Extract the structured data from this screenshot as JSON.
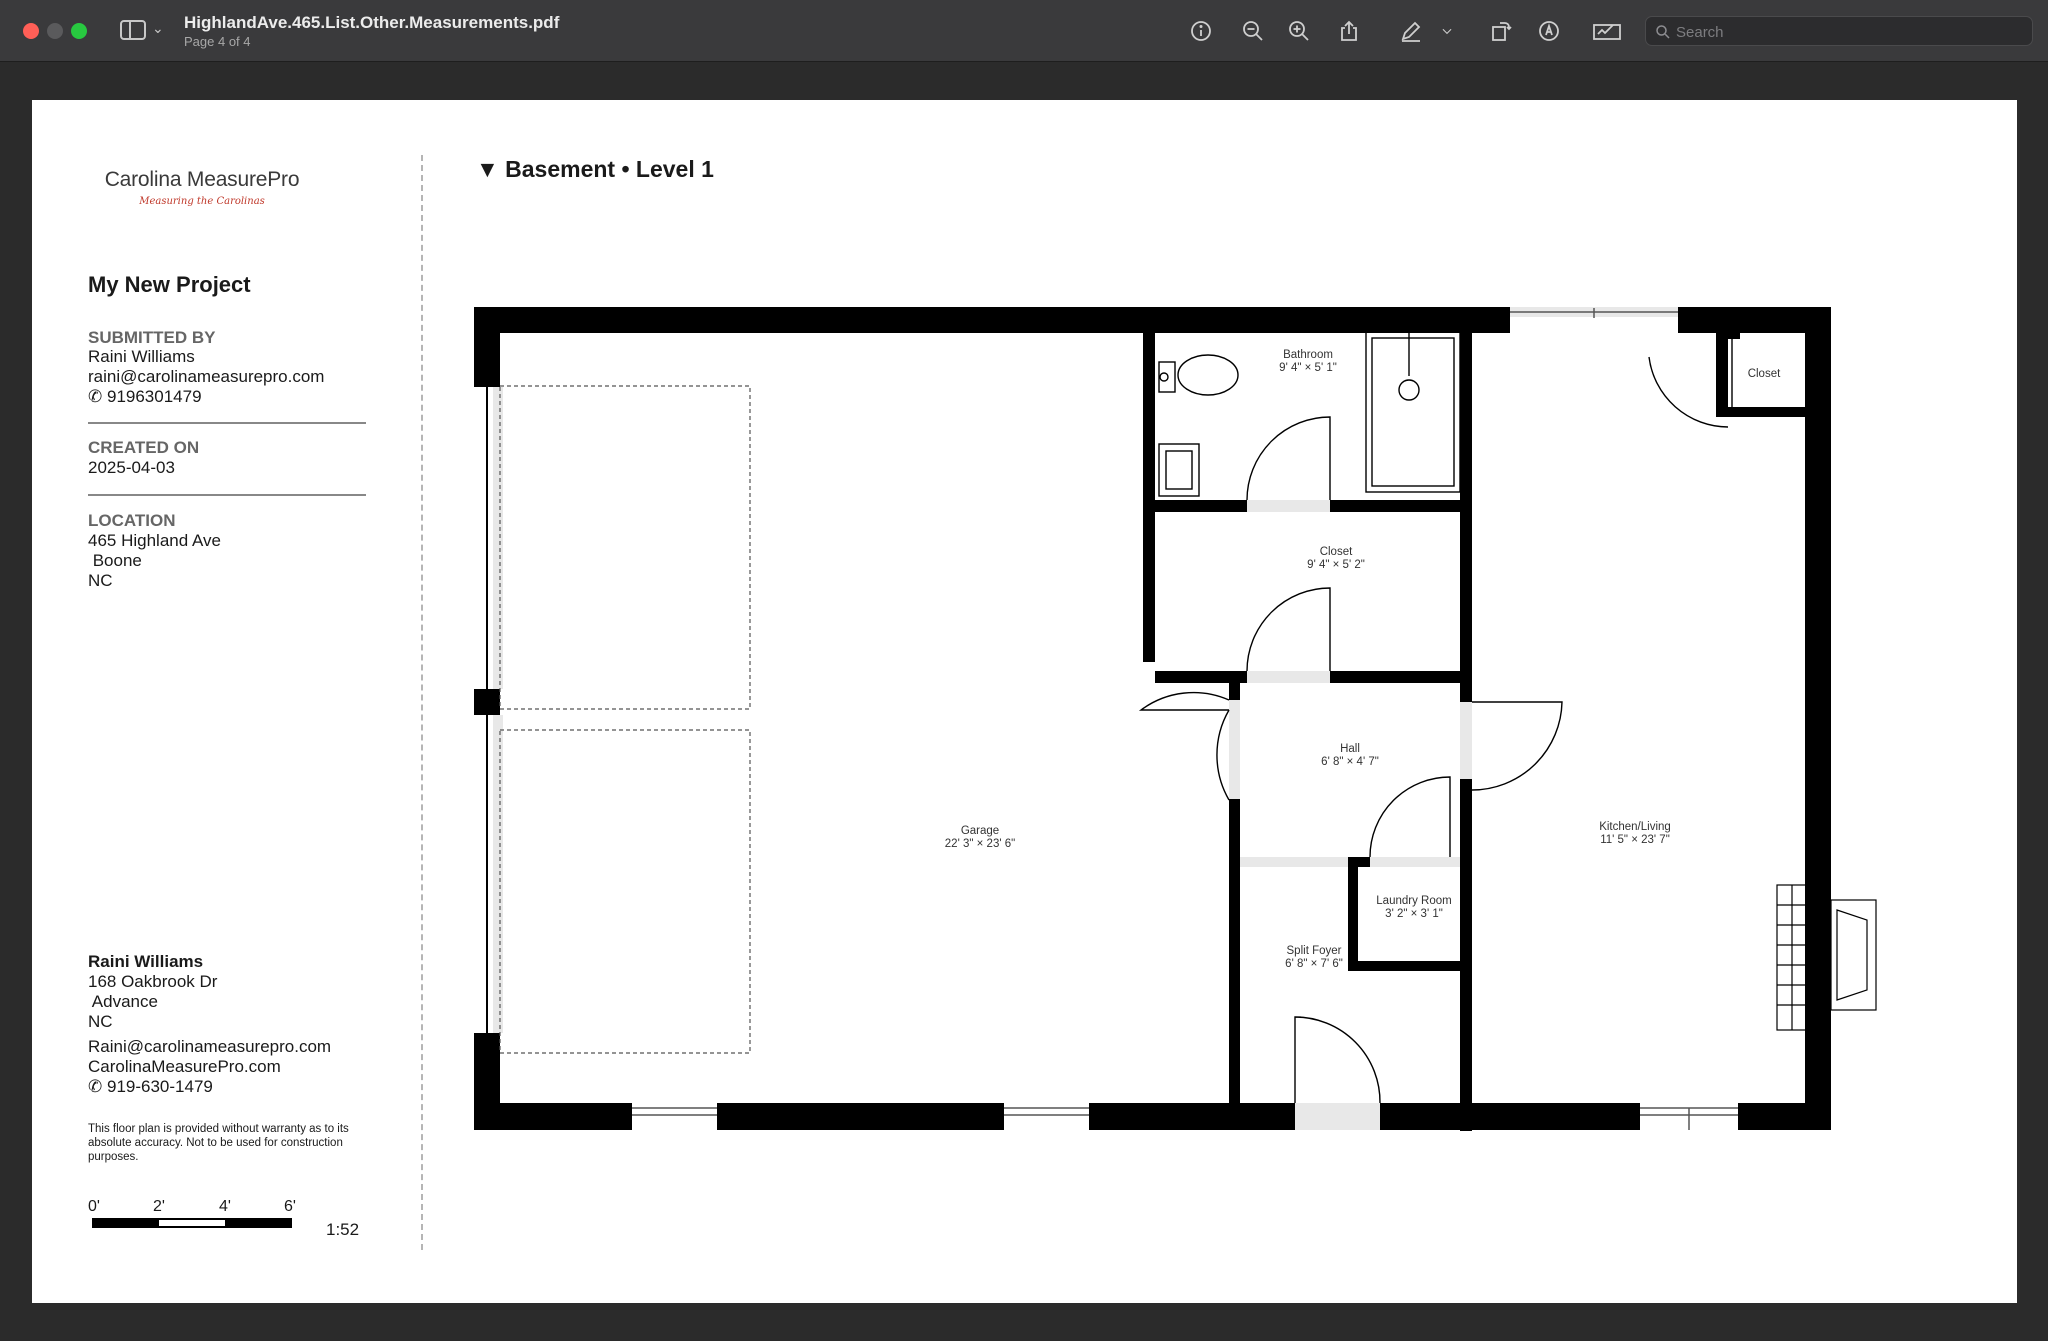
{
  "window": {
    "title": "HighlandAve.465.List.Other.Measurements.pdf",
    "subtitle": "Page 4 of 4"
  },
  "toolbar": {
    "icons": [
      "info-icon",
      "zoom-out-icon",
      "zoom-in-icon",
      "share-icon",
      "markup-pen-icon",
      "chevron-down-icon",
      "rotate-icon",
      "annotate-icon",
      "signature-icon"
    ],
    "search_placeholder": "Search"
  },
  "brand": {
    "name": "Carolina MeasurePro",
    "tagline": "Measuring the Carolinas"
  },
  "project": {
    "title": "My New Project",
    "submitted_label": "SUBMITTED BY",
    "submitted_name": "Raini Williams",
    "submitted_email": "raini@carolinameasurepro.com",
    "submitted_phone": "9196301479",
    "created_label": "CREATED ON",
    "created_date": "2025-04-03",
    "location_label": "LOCATION",
    "location_street": "465 Highland Ave",
    "location_city": " Boone",
    "location_state": "NC"
  },
  "contact": {
    "name": "Raini Williams",
    "street": "168 Oakbrook Dr",
    "city": " Advance",
    "state": "NC",
    "email": "Raini@carolinameasurepro.com",
    "website": "CarolinaMeasurePro.com",
    "phone": "919-630-1479"
  },
  "disclaimer": "This floor plan is provided without warranty as to its absolute accuracy. Not to be used for construction purposes.",
  "scale": {
    "ticks": [
      "0'",
      "2'",
      "4'",
      "6'"
    ],
    "ratio": "1:52"
  },
  "level": {
    "title": "▼  Basement • Level 1"
  },
  "rooms": {
    "garage": {
      "name": "Garage",
      "dims": "22' 3\" × 23' 6\""
    },
    "bathroom": {
      "name": "Bathroom",
      "dims": "9' 4\" × 5' 1\""
    },
    "closet_mid": {
      "name": "Closet",
      "dims": "9' 4\" × 5' 2\""
    },
    "hall": {
      "name": "Hall",
      "dims": "6' 8\" × 4' 7\""
    },
    "laundry": {
      "name": "Laundry Room",
      "dims": "3' 2\" × 3' 1\""
    },
    "foyer": {
      "name": "Split Foyer",
      "dims": "6' 8\" × 7' 6\""
    },
    "kitchen": {
      "name": "Kitchen/Living",
      "dims": "11' 5\" × 23' 7\""
    },
    "closet_small": {
      "name": "Closet"
    }
  }
}
